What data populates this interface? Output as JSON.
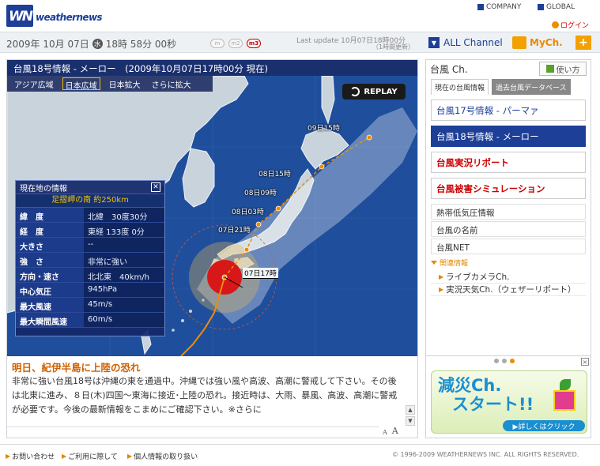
{
  "brand": {
    "name": "weathernews",
    "mark": "WN"
  },
  "topnav": {
    "company": "COMPANY",
    "global": "GLOBAL",
    "login": "ログイン"
  },
  "datebar": {
    "datetime_a": "2009年 10月 07日",
    "weekday_icon": "水",
    "datetime_b": "18時 58分 00秒",
    "size_buttons": [
      "m",
      "m2",
      "m3"
    ],
    "last_update": "Last update  10月07日18時00分",
    "last_update_sub": "（1時間更新）",
    "all_channel": "ALL Channel",
    "mych": "MyCh.",
    "plus": "+"
  },
  "main": {
    "title": "台風18号情報 - メーロー　(2009年10月07日17時00分 現在)",
    "map_tabs": [
      {
        "label": "アジア広域",
        "active": false
      },
      {
        "label": "日本広域",
        "active": true
      },
      {
        "label": "日本拡大",
        "active": false
      },
      {
        "label": "さらに拡大",
        "active": false
      }
    ],
    "replay": "REPLAY",
    "track_labels": [
      "09日15時",
      "08日15時",
      "08日09時",
      "08日03時",
      "07日21時",
      "07日17時"
    ],
    "colors": {
      "header_bg": "#1a2f6e",
      "sea": "#1f4f9c",
      "land": "#c8d3dc",
      "storm_red": "#d81818",
      "storm_ring": "#e2b85a"
    },
    "info": {
      "title": "現在地の情報",
      "location": "足摺岬の南 約250km",
      "rows": [
        {
          "k": "緯　度",
          "v": "北緯　30度30分"
        },
        {
          "k": "経　度",
          "v": "東経 133度 0分"
        },
        {
          "k": "大きさ",
          "v": "--"
        },
        {
          "k": "強　さ",
          "v": "非常に強い"
        },
        {
          "k": "方向・速さ",
          "v": "北北東　40km/h"
        },
        {
          "k": "中心気圧",
          "v": "945hPa"
        },
        {
          "k": "最大風速",
          "v": "45m/s"
        },
        {
          "k": "最大瞬間風速",
          "v": "60m/s"
        }
      ]
    },
    "headline": "明日、紀伊半島に上陸の恐れ",
    "body": "非常に強い台風18号は沖縄の東を通過中。沖縄では強い風や高波、高潮に警戒して下さい。その後は北東に進み、８日(木)四国～東海に接近･上陸の恐れ。接近時は、大雨、暴風、高波、高潮に警戒が必要です。今後の最新情報をこまめにご確認下さい。※さらに",
    "text_sizes": [
      "A",
      "A",
      "A"
    ]
  },
  "sidebar": {
    "title": "台風 Ch.",
    "howto": "使い方",
    "tabs": [
      "現在の台風情報",
      "過去台風データベース"
    ],
    "items": [
      {
        "label": "台風17号情報 - パーマァ",
        "style": "normal"
      },
      {
        "label": "台風18号情報 - メーロー",
        "style": "selected"
      },
      {
        "label": "台風実況リポート",
        "style": "red"
      },
      {
        "label": "台風被害シミュレーション",
        "style": "red"
      },
      {
        "label": "熱帯低気圧情報",
        "style": "plain"
      },
      {
        "label": "台風の名前",
        "style": "plain"
      },
      {
        "label": "台風NET",
        "style": "plain"
      }
    ],
    "related_title": "関連情報",
    "related": [
      "ライブカメラCh.",
      "実況天気Ch.（ウェザーリポート）"
    ]
  },
  "ad": {
    "title_a": "減災Ch.",
    "title_b": "スタート!!",
    "cta": "▶詳しくはクリック",
    "close": "×"
  },
  "footer": {
    "links": [
      "お問い合わせ",
      "ご利用に際して",
      "個人情報の取り扱い"
    ],
    "copyright": "© 1996-2009 WEATHERNEWS INC. ALL RIGHTS RESERVED."
  }
}
